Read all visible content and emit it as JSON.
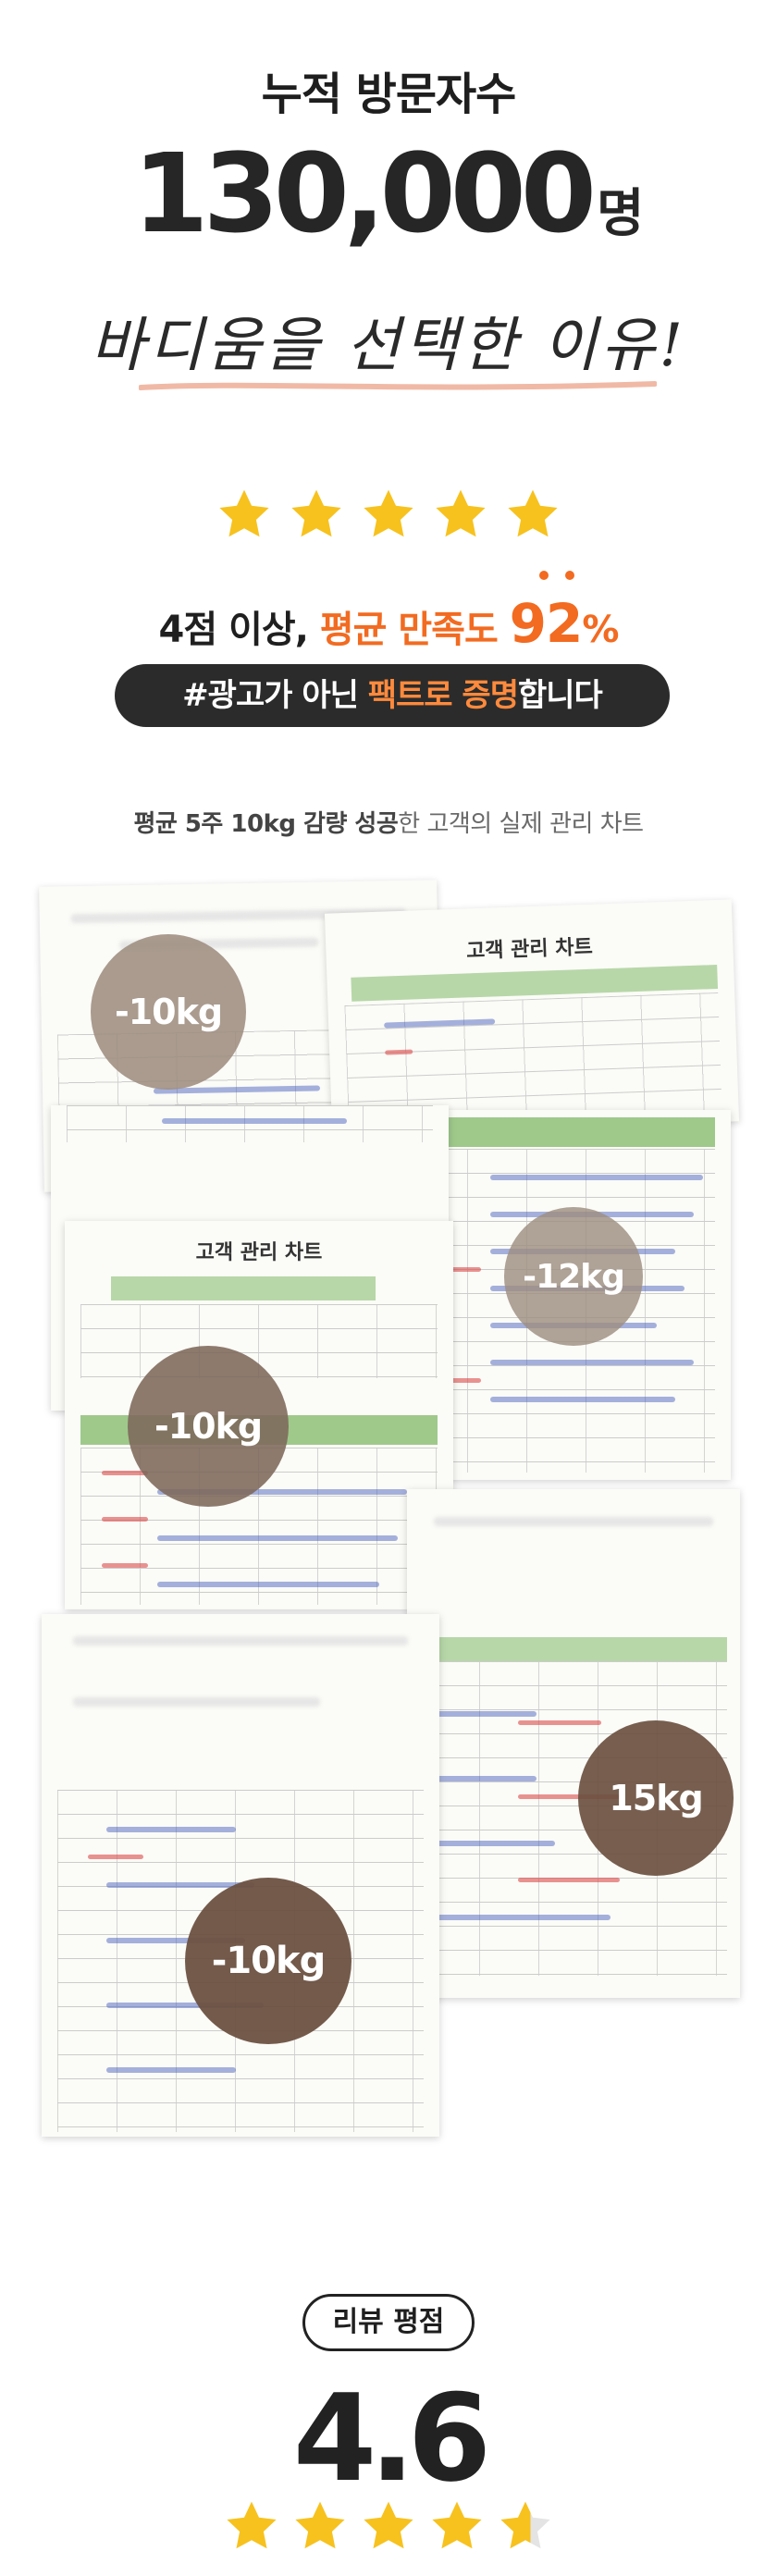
{
  "hero": {
    "title": "누적 방문자수",
    "count": "130,000",
    "count_unit": "명",
    "script_line": "바디움을 선택한 이유!"
  },
  "rating_section": {
    "stars": 5,
    "satisfaction_prefix": "4점 이상, ",
    "satisfaction_orange": "평균 만족도 ",
    "satisfaction_value": "92",
    "satisfaction_unit": "%",
    "pill_prefix": "#광고가 아닌 ",
    "pill_orange": "팩트로 증명",
    "pill_suffix": "합니다"
  },
  "charts_section": {
    "caption_bold": "평균 5주 10kg 감량 성공",
    "caption_rest": "한 고객의 실제 관리 차트",
    "sheet_title_1": "고객 관리 차트",
    "sheet_title_2": "고객 관리 차트",
    "badges": [
      "-10kg",
      "-12kg",
      "-10kg",
      "15kg",
      "-10kg"
    ]
  },
  "review": {
    "label": "리뷰 평점",
    "score": "4.6",
    "stars_value": 4.6
  },
  "colors": {
    "accent_orange": "#f26b21",
    "star_yellow": "#f7c21e",
    "dark_pill": "#2b2b2b",
    "badge_brown": "#6b5040",
    "badge_taupe": "#9e8d80"
  }
}
